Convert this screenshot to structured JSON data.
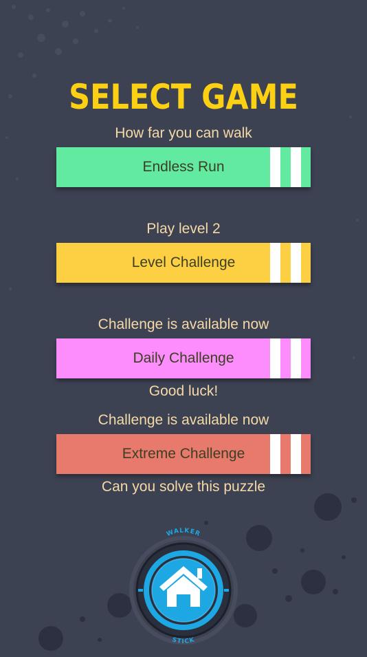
{
  "title": "SELECT GAME",
  "colors": {
    "background": "#3d4253",
    "title": "#fcd113",
    "caption": "#f5d9a6",
    "endless": "#62eba0",
    "level": "#fdd044",
    "daily": "#fd8dfc",
    "extreme": "#e8796d",
    "home_ring": "#1da7e3"
  },
  "modes": [
    {
      "caption": "How far you can walk",
      "label": "Endless Run"
    },
    {
      "caption": "Play level 2",
      "label": "Level Challenge"
    },
    {
      "caption": "Challenge is available now",
      "label": "Daily Challenge",
      "sub_caption": "Good luck!"
    },
    {
      "caption": "Challenge is available now",
      "label": "Extreme Challenge",
      "sub_caption": "Can you solve this puzzle"
    }
  ],
  "home_badge": {
    "top_text": "WALKER",
    "bottom_text": "STICK",
    "icon": "home-icon"
  }
}
